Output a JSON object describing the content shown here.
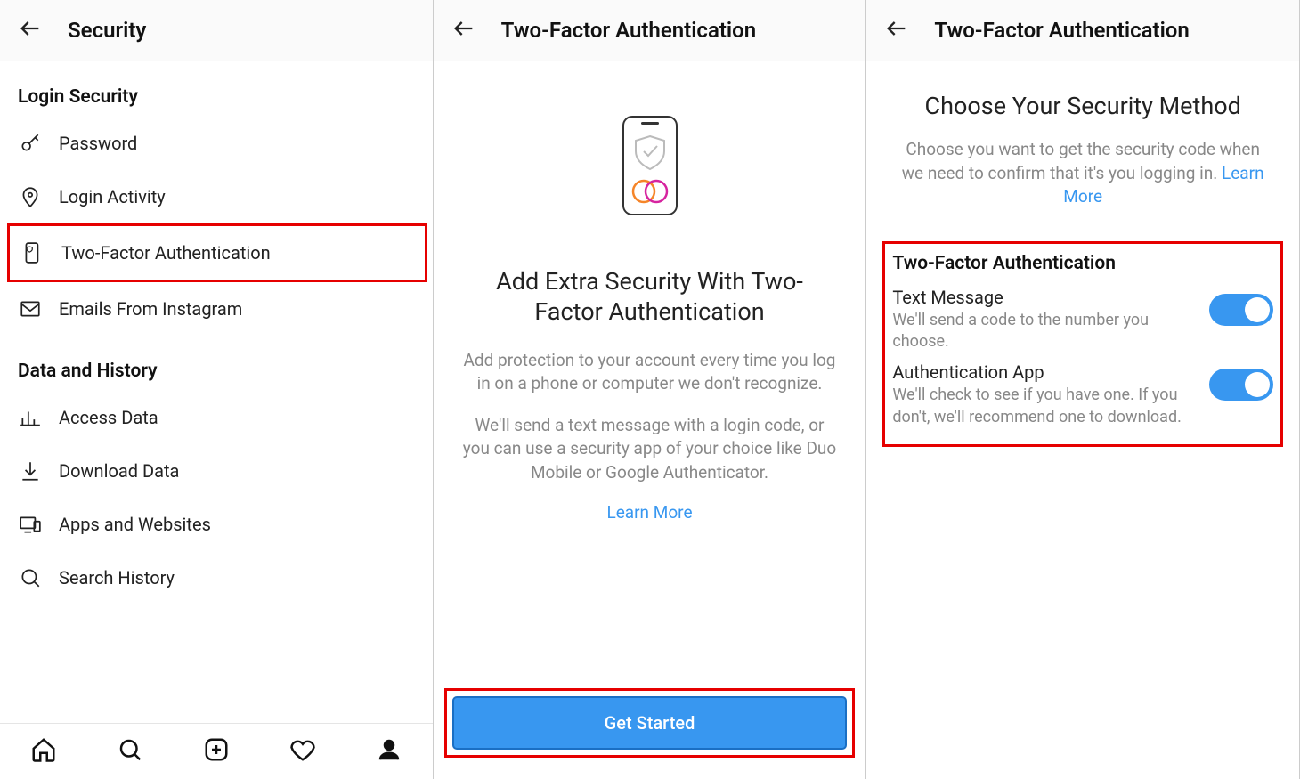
{
  "screen1": {
    "title": "Security",
    "sections": {
      "login_security": {
        "heading": "Login Security",
        "items": {
          "password": "Password",
          "login_activity": "Login Activity",
          "two_factor": "Two-Factor Authentication",
          "emails": "Emails From Instagram"
        }
      },
      "data_history": {
        "heading": "Data and History",
        "items": {
          "access_data": "Access Data",
          "download_data": "Download Data",
          "apps_websites": "Apps and Websites",
          "search_history": "Search History"
        }
      }
    }
  },
  "screen2": {
    "title": "Two-Factor Authentication",
    "intro_title": "Add Extra Security With Two-Factor Authentication",
    "desc1": "Add protection to your account every time you log in on a phone or computer we don't recognize.",
    "desc2": "We'll send a text message with a login code, or you can use a security app of your choice like Duo Mobile or Google Authenticator.",
    "learn_more": "Learn More",
    "cta": "Get Started"
  },
  "screen3": {
    "title": "Two-Factor Authentication",
    "choose_title": "Choose Your Security Method",
    "choose_desc": "Choose you want to get the security code when we need to confirm that it's you logging in.",
    "learn_more": "Learn More",
    "box_title": "Two-Factor Authentication",
    "methods": {
      "text_message": {
        "name": "Text Message",
        "sub": "We'll send a code to the number you choose."
      },
      "auth_app": {
        "name": "Authentication App",
        "sub": "We'll check to see if you have one. If you don't, we'll recommend one to download."
      }
    }
  }
}
